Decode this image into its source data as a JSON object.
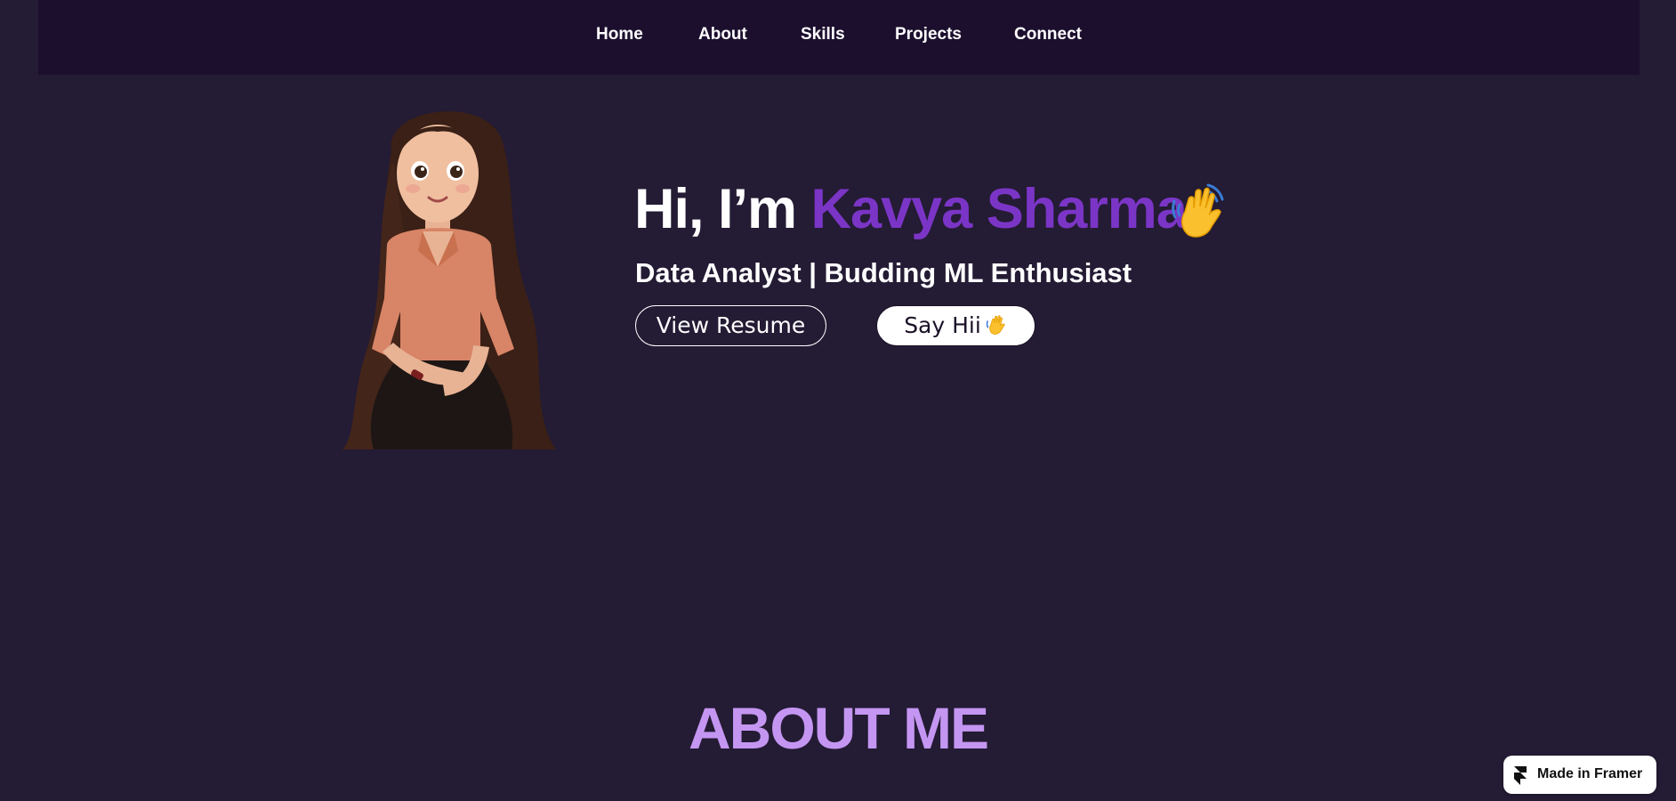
{
  "nav": {
    "items": [
      {
        "label": "Home"
      },
      {
        "label": "About"
      },
      {
        "label": "Skills"
      },
      {
        "label": "Projects"
      },
      {
        "label": "Connect"
      }
    ]
  },
  "hero": {
    "greeting": "Hi, I’m ",
    "name": "Kavya Sharma",
    "subtitle": "Data Analyst | Budding ML Enthusiast",
    "resume_button": "View Resume",
    "sayhii_button": "Say Hii",
    "avatar_icon": "cartoon-girl-avatar",
    "wave_icon": "waving-hand-icon"
  },
  "about": {
    "heading": "ABOUT ME"
  },
  "framer_badge": {
    "label": "Made in Framer",
    "icon": "framer-logo-icon"
  },
  "colors": {
    "background": "#241b34",
    "nav_background": "#1c0f2e",
    "name_accent": "#7b35c6",
    "about_heading": "#c496f2"
  }
}
